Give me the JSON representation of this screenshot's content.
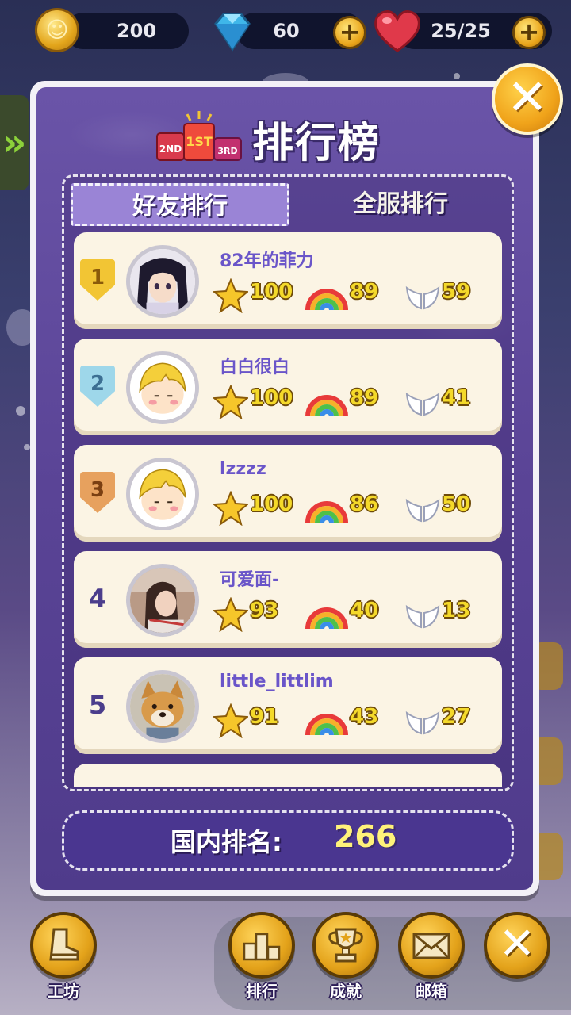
{
  "topbar": {
    "coins": "200",
    "gems": "60",
    "lives": "25/25",
    "coin_icon": "coin-icon",
    "gem_icon": "diamond-icon",
    "heart_icon": "heart-icon",
    "plus_symbol": "+"
  },
  "modal": {
    "title": "排行榜",
    "podium_labels": [
      "2ND",
      "1ST",
      "3RD"
    ],
    "close_symbol": "✕",
    "tabs": [
      {
        "label": "好友排行",
        "active": true
      },
      {
        "label": "全服排行",
        "active": false
      }
    ],
    "rows": [
      {
        "rank": "1",
        "name": "82年的菲力",
        "stars": "100",
        "rainbows": "89",
        "wings": "59",
        "badge_color": "#f2c534",
        "badge_text_color": "#8a5a0a",
        "avatar": "anime-girl-avatar"
      },
      {
        "rank": "2",
        "name": "白白很白",
        "stars": "100",
        "rainbows": "89",
        "wings": "41",
        "badge_color": "#9ed7ea",
        "badge_text_color": "#3c6f93",
        "avatar": "blond-boy-avatar"
      },
      {
        "rank": "3",
        "name": "lzzzz",
        "stars": "100",
        "rainbows": "86",
        "wings": "50",
        "badge_color": "#e7a15e",
        "badge_text_color": "#7a3f12",
        "avatar": "blond-boy-avatar"
      },
      {
        "rank": "4",
        "name": "可爱面-",
        "stars": "93",
        "rainbows": "40",
        "wings": "13",
        "avatar": "girl-photo-avatar"
      },
      {
        "rank": "5",
        "name": "little_littlim",
        "stars": "91",
        "rainbows": "43",
        "wings": "27",
        "avatar": "shiba-dog-avatar"
      }
    ],
    "national_rank_label": "国内排名:",
    "national_rank_value": "266"
  },
  "bottom_nav": {
    "workshop": "工坊",
    "ranking": "排行",
    "achievements": "成就",
    "mailbox": "邮箱",
    "close_symbol": "✕"
  },
  "colors": {
    "panel_purple": "#5a4496",
    "row_cream": "#fbf4e4",
    "stat_yellow": "#f4d92a",
    "name_purple": "#6a55c9",
    "button_gold": "#e3a21a"
  }
}
